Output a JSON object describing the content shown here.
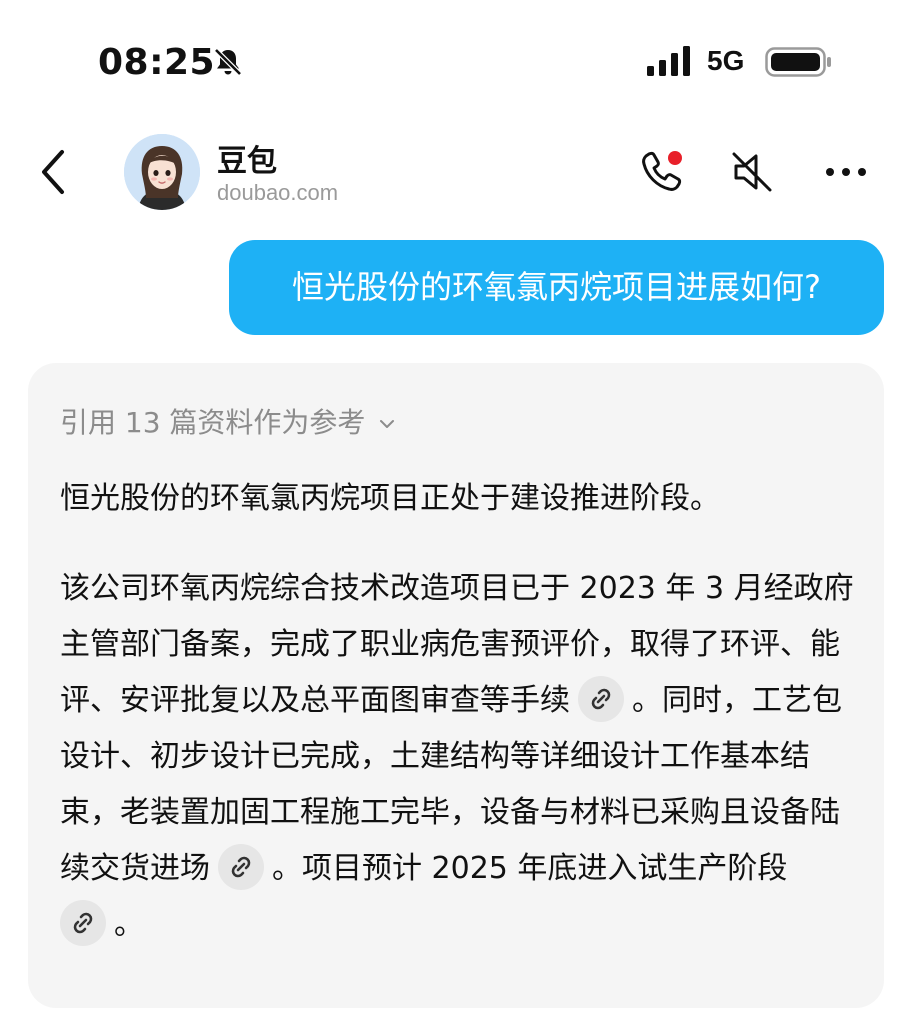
{
  "status_bar": {
    "time": "08:25",
    "network": "5G",
    "silent_icon": "bell-slash-icon",
    "signal_icon": "signal-bars-icon",
    "battery_icon": "battery-icon"
  },
  "header": {
    "name": "豆包",
    "domain": "doubao.com",
    "icons": [
      "back-chevron-icon",
      "phone-call-icon",
      "speaker-mute-icon",
      "more-dots-icon"
    ],
    "call_badge_color": "#e8202a"
  },
  "user_message": "恒光股份的环氧氯丙烷项目进展如何?",
  "answer": {
    "references_label": "引用 13 篇资料作为参考",
    "summary": "恒光股份的环氧氯丙烷项目正处于建设推进阶段。",
    "detail_part1": "该公司环氧丙烷综合技术改造项目已于 2023 年 3 月经政府主管部门备案，完成了职业病危害预评价，取得了环评、能评、安评批复以及总平面图审查等手续",
    "detail_part2": "。同时，工艺包设计、初步设计已完成，土建结构等详细设计工作基本结束，老装置加固工程施工完毕，设备与材料已采购且设备陆续交货进场",
    "detail_part3": "。项目预计 2025 年底进入试生产阶段",
    "detail_part4": "。"
  },
  "colors": {
    "user_bubble": "#1eb1f5",
    "answer_card": "#f5f5f5",
    "muted_text": "#8c8c8c"
  }
}
